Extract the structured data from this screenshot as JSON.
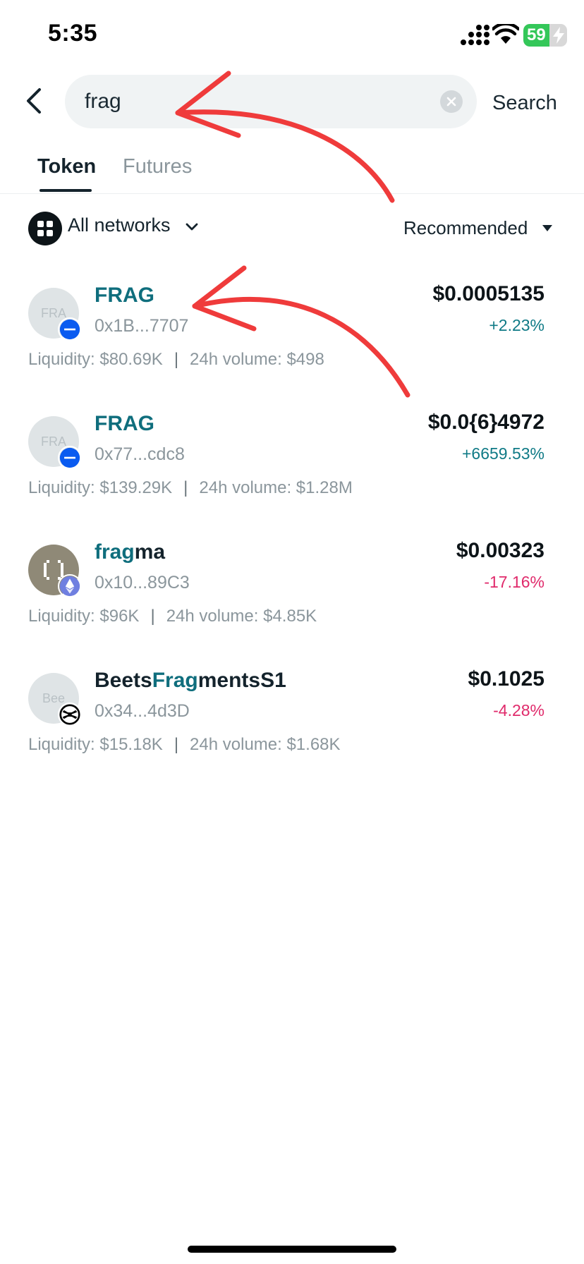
{
  "status": {
    "time": "5:35",
    "battery": "59"
  },
  "search": {
    "query": "frag",
    "action_label": "Search"
  },
  "tabs": [
    {
      "label": "Token"
    },
    {
      "label": "Futures"
    }
  ],
  "filters": {
    "network_label": "All networks",
    "sort_label": "Recommended"
  },
  "tokens": [
    {
      "name_highlight": "FRAG",
      "name_rest": "",
      "avatar_text": "FRA",
      "address": "0x1B...7707",
      "price": "$0.0005135",
      "change": "+2.23%",
      "liquidity": "Liquidity: $80.69K",
      "volume": "24h volume: $498",
      "network_icon": "blue-network-icon"
    },
    {
      "name_highlight": "FRAG",
      "name_rest": "",
      "avatar_text": "FRA",
      "address": "0x77...cdc8",
      "price": "$0.0{6}4972",
      "change": "+6659.53%",
      "liquidity": "Liquidity: $139.29K",
      "volume": "24h volume: $1.28M",
      "network_icon": "blue-network-icon"
    },
    {
      "name_highlight": "frag",
      "name_rest": "ma",
      "avatar_text": "",
      "address": "0x10...89C3",
      "price": "$0.00323",
      "change": "-17.16%",
      "liquidity": "Liquidity: $96K",
      "volume": "24h volume: $4.85K",
      "network_icon": "ethereum-icon"
    },
    {
      "name_prefix": "Beets",
      "name_highlight": "Frag",
      "name_rest": "mentsS1",
      "avatar_text": "Bee",
      "address": "0x34...4d3D",
      "price": "$0.1025",
      "change": "-4.28%",
      "liquidity": "Liquidity: $15.18K",
      "volume": "24h volume: $1.68K",
      "network_icon": "sonic-network-icon"
    }
  ],
  "colors": {
    "accent": "#0f6e7d",
    "positive": "#0f7a86",
    "negative": "#e02a6b",
    "annotation": "#ef3b3b",
    "battery": "#34c759"
  }
}
